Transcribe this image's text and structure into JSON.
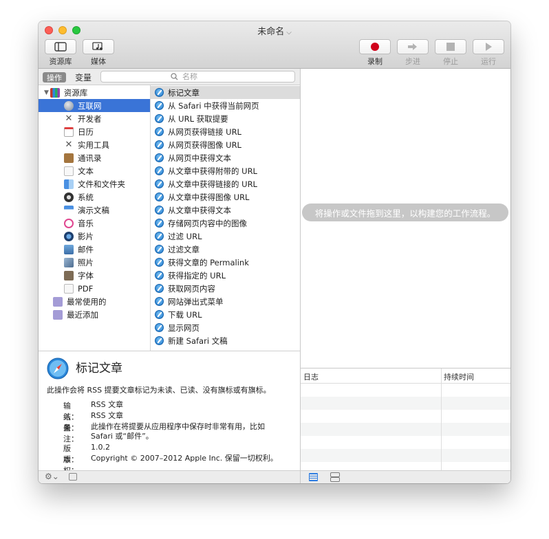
{
  "window": {
    "title": "未命名"
  },
  "toolbar": {
    "library_label": "资源库",
    "media_label": "媒体",
    "record_label": "录制",
    "step_label": "步进",
    "stop_label": "停止",
    "run_label": "运行"
  },
  "tabs": {
    "actions": "操作",
    "variables": "变量"
  },
  "search": {
    "placeholder": "名称"
  },
  "library": {
    "root": "资源库",
    "items": [
      "互联网",
      "开发者",
      "日历",
      "实用工具",
      "通讯录",
      "文本",
      "文件和文件夹",
      "系统",
      "演示文稿",
      "音乐",
      "影片",
      "邮件",
      "照片",
      "字体",
      "PDF"
    ],
    "smart_folders": [
      "最常使用的",
      "最近添加"
    ]
  },
  "actions": [
    "标记文章",
    "从 Safari 中获得当前网页",
    "从 URL 获取提要",
    "从网页获得链接 URL",
    "从网页获得图像 URL",
    "从网页中获得文本",
    "从文章中获得附带的 URL",
    "从文章中获得链接的 URL",
    "从文章中获得图像 URL",
    "从文章中获得文本",
    "存储网页内容中的图像",
    "过滤 URL",
    "过滤文章",
    "获得文章的 Permalink",
    "获得指定的 URL",
    "获取网页内容",
    "网站弹出式菜单",
    "下载 URL",
    "显示网页",
    "新建 Safari 文稿"
  ],
  "description": {
    "title": "标记文章",
    "summary": "此操作会将 RSS 提要文章标记为未读、已读、没有旗标或有旗标。",
    "input_key": "输入：",
    "input_val": "RSS 文章",
    "result_key": "结果：",
    "result_val": "RSS 文章",
    "note_key": "备注：",
    "note_val": "此操作在将提要从应用程序中保存时非常有用，比如 Safari 或“邮件”。",
    "version_key": "版本：",
    "version_val": "1.0.2",
    "copyright_key": "版权：",
    "copyright_val": "Copyright © 2007–2012 Apple Inc. 保留一切权利。"
  },
  "workflow": {
    "drop_hint": "将操作或文件拖到这里，以构建您的工作流程。"
  },
  "log": {
    "col_log": "日志",
    "col_duration": "持续时间"
  },
  "colors": {
    "selection": "#3a74d7",
    "record": "#d0021b",
    "drop_hint_bg": "#c7c7c7"
  }
}
